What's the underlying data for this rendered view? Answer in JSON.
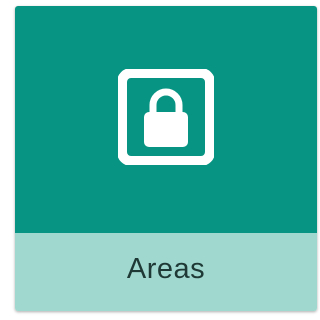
{
  "tile": {
    "label": "Areas",
    "icon": "lock-square-icon",
    "colors": {
      "header": "#089482",
      "footer": "#a0d8cf",
      "icon": "#ffffff",
      "label": "#1f3a36"
    }
  }
}
